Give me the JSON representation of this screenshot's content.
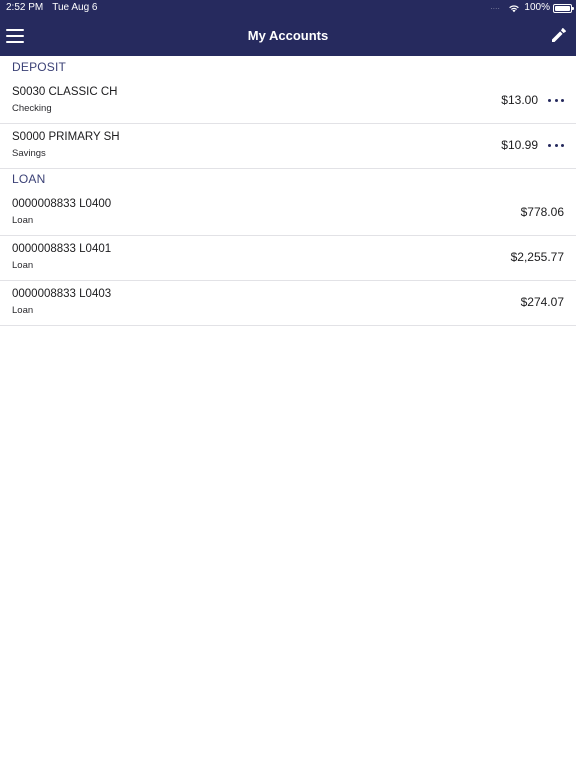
{
  "status_bar": {
    "time": "2:52 PM",
    "date": "Tue Aug 6",
    "signal_dots": "....",
    "battery_percent": "100%",
    "battery_level": 1.0
  },
  "nav": {
    "title": "My Accounts",
    "menu_icon": "hamburger-menu-icon",
    "edit_icon": "pencil-icon"
  },
  "colors": {
    "brand_navy": "#262a5e",
    "section_header": "#3b4176",
    "divider": "#e2e2e6"
  },
  "sections": [
    {
      "title": "DEPOSIT",
      "accounts": [
        {
          "name": "S0030 CLASSIC CH",
          "type": "Checking",
          "balance": "$13.00",
          "has_more": true
        },
        {
          "name": "S0000 PRIMARY SH",
          "type": "Savings",
          "balance": "$10.99",
          "has_more": true
        }
      ]
    },
    {
      "title": "LOAN",
      "accounts": [
        {
          "name": "0000008833 L0400",
          "type": "Loan",
          "balance": "$778.06",
          "has_more": false
        },
        {
          "name": "0000008833 L0401",
          "type": "Loan",
          "balance": "$2,255.77",
          "has_more": false
        },
        {
          "name": "0000008833 L0403",
          "type": "Loan",
          "balance": "$274.07",
          "has_more": false
        }
      ]
    }
  ]
}
